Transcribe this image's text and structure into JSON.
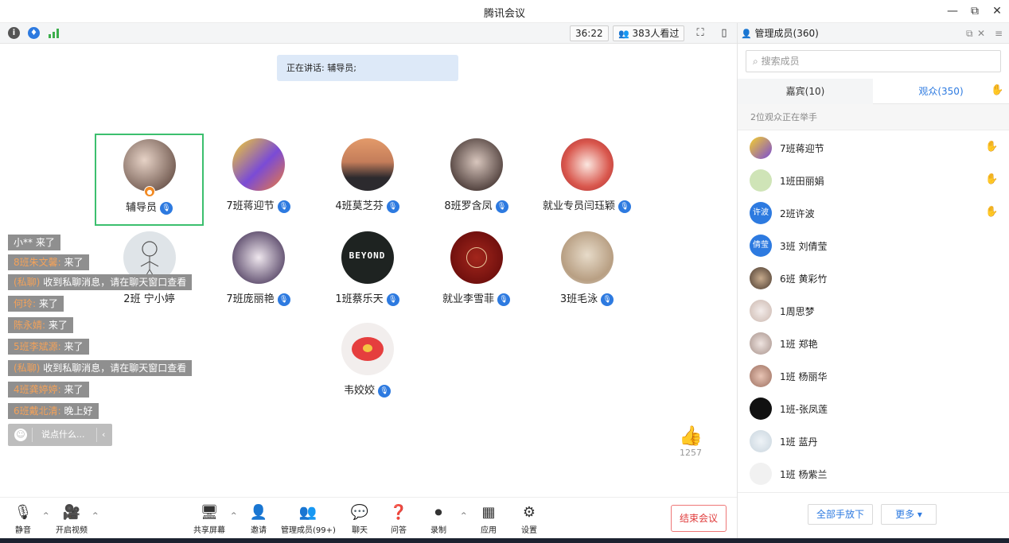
{
  "window": {
    "title": "腾讯会议",
    "minimize": "—",
    "restore": "⧉",
    "close": "✕"
  },
  "toolbar": {
    "timer": "36:22",
    "viewers": "383人看过",
    "info_icon": "i",
    "shield_icon": "♦",
    "fullscreen_icon": "⛶",
    "layout_icon": "▯"
  },
  "speaking": "正在讲话: 辅导员;",
  "tiles": [
    {
      "name": "辅导员",
      "active": true,
      "host": true
    },
    {
      "name": "7班蒋迎节"
    },
    {
      "name": "4班莫芝芬"
    },
    {
      "name": "8班罗含凤"
    },
    {
      "name": "就业专员闫珏颖"
    },
    {
      "name": "2班  宁小婷"
    },
    {
      "name": "7班庞丽艳"
    },
    {
      "name": "1班蔡乐天"
    },
    {
      "name": "就业李雪菲"
    },
    {
      "name": "3班毛泳"
    },
    {
      "name": "韦姣姣"
    }
  ],
  "chat": [
    {
      "name": "",
      "text": "小** 来了"
    },
    {
      "name": "8班朱文馨:",
      "text": " 来了"
    },
    {
      "name": "(私聊)",
      "text": " 收到私聊消息，请在聊天窗口查看"
    },
    {
      "name": "何玲:",
      "text": " 来了"
    },
    {
      "name": "陈永婧:",
      "text": " 来了"
    },
    {
      "name": "5班李斌源:",
      "text": " 来了"
    },
    {
      "name": "(私聊)",
      "text": " 收到私聊消息，请在聊天窗口查看"
    },
    {
      "name": "4班龚婷婷:",
      "text": " 来了"
    },
    {
      "name": "6班戴北清:",
      "text": " 晚上好"
    }
  ],
  "chat_input_placeholder": "说点什么...",
  "likes": "1257",
  "bottom": {
    "mute": "静音",
    "video": "开启视频",
    "share": "共享屏幕",
    "invite": "邀请",
    "members": "管理成员(99+)",
    "chat": "聊天",
    "qa": "问答",
    "record": "录制",
    "apps": "应用",
    "settings": "设置",
    "end": "结束会议"
  },
  "panel": {
    "title": "管理成员(360)",
    "search_placeholder": "搜索成员",
    "tab_guests": "嘉宾(10)",
    "tab_audience": "观众(350)",
    "hand_note": "2位观众正在举手",
    "members": [
      {
        "name": "7班蒋迎节",
        "hand": "lowered"
      },
      {
        "name": "1班田丽娟",
        "hand": "raised"
      },
      {
        "name": "2班许波",
        "hand": "raised",
        "initials": "许波"
      },
      {
        "name": "3班  刘倩莹",
        "initials": "倩莹"
      },
      {
        "name": "6班  黄彩竹"
      },
      {
        "name": "1周思梦"
      },
      {
        "name": "1班  郑艳"
      },
      {
        "name": "1班 杨丽华"
      },
      {
        "name": "1班-张凤莲"
      },
      {
        "name": "1班 蓝丹"
      },
      {
        "name": "1班 杨紫兰"
      }
    ],
    "all_hands_down": "全部手放下",
    "more": "更多 ▾"
  }
}
